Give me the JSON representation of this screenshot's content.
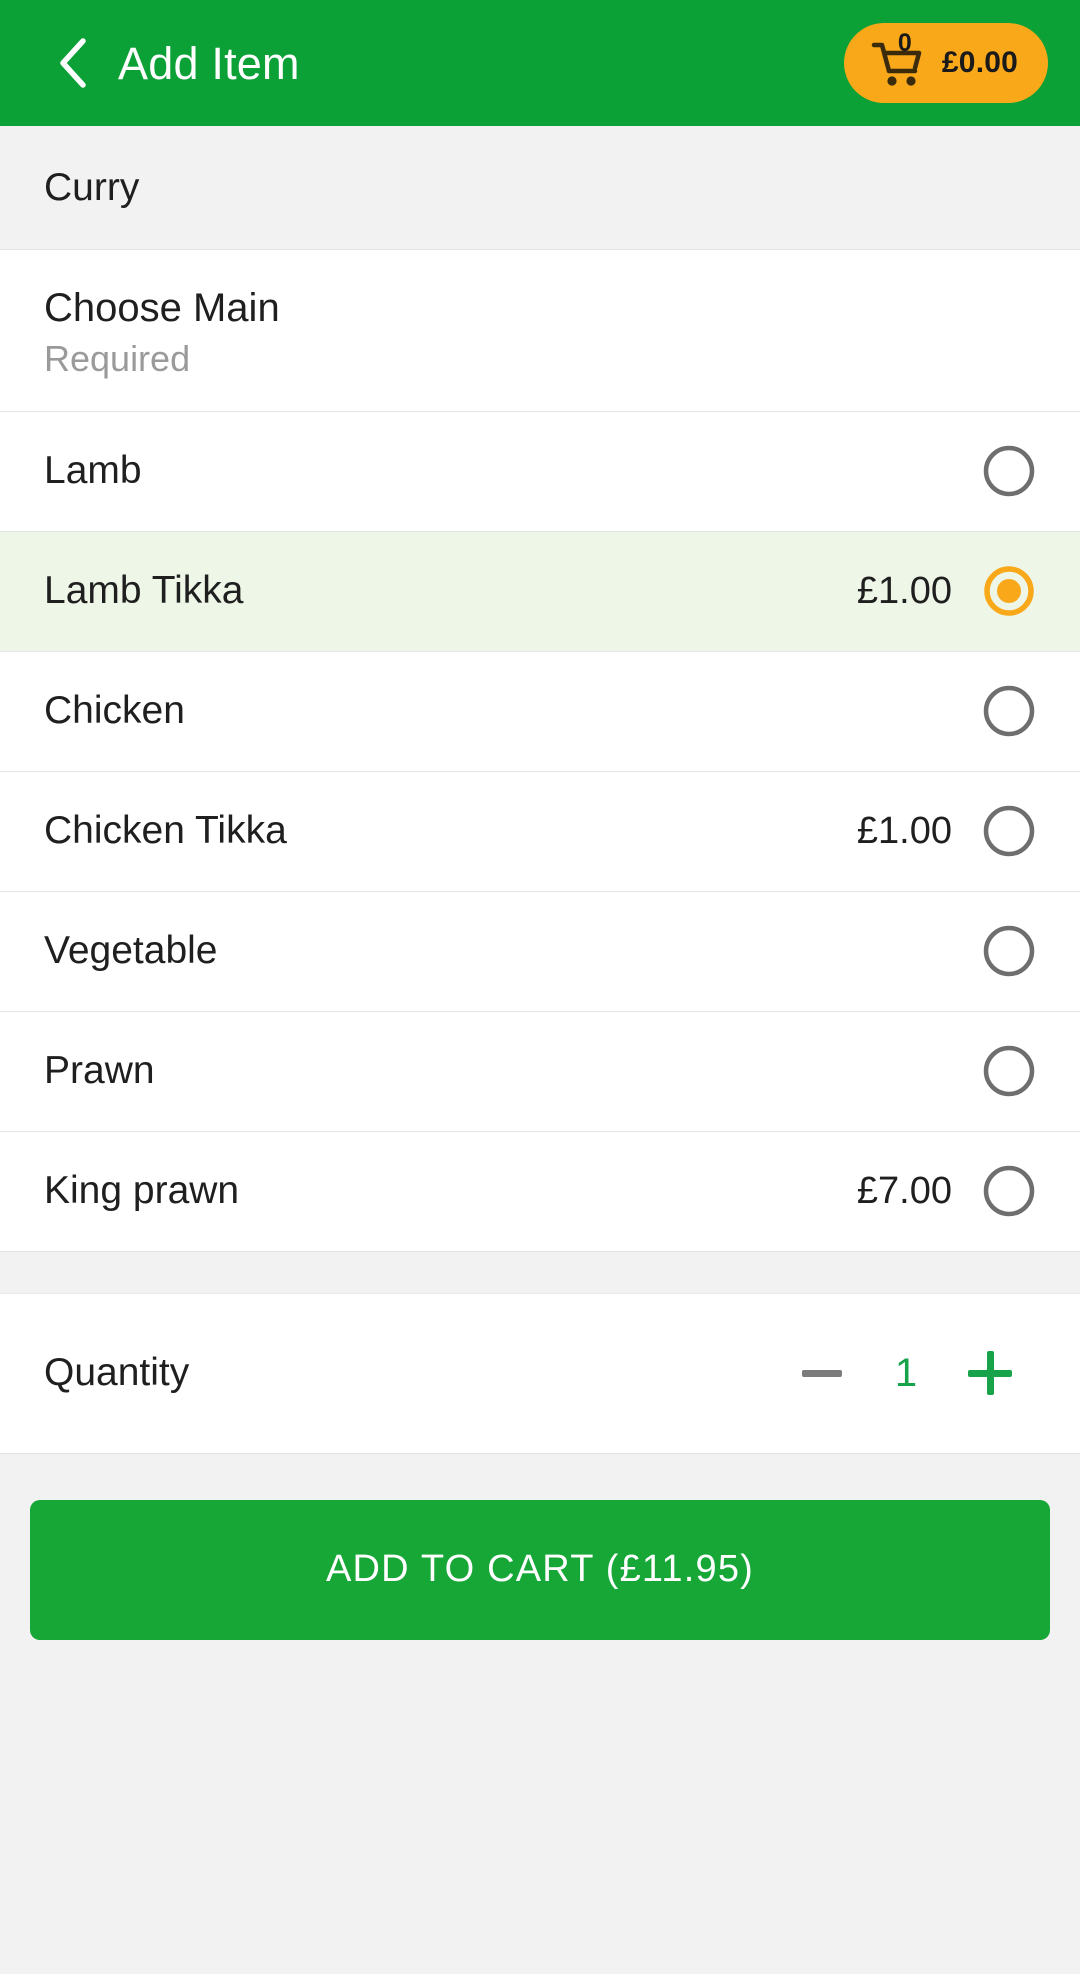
{
  "header": {
    "back_icon": "chevron-left-icon",
    "title": "Add Item",
    "cart": {
      "icon": "shopping-cart-icon",
      "count": "0",
      "total": "£0.00"
    }
  },
  "category": {
    "label": "Curry"
  },
  "group": {
    "title": "Choose Main",
    "subtitle": "Required"
  },
  "options": [
    {
      "label": "Lamb",
      "price": "",
      "selected": false
    },
    {
      "label": "Lamb Tikka",
      "price": "£1.00",
      "selected": true
    },
    {
      "label": "Chicken",
      "price": "",
      "selected": false
    },
    {
      "label": "Chicken Tikka",
      "price": "£1.00",
      "selected": false
    },
    {
      "label": "Vegetable",
      "price": "",
      "selected": false
    },
    {
      "label": "Prawn",
      "price": "",
      "selected": false
    },
    {
      "label": "King prawn",
      "price": "£7.00",
      "selected": false
    }
  ],
  "quantity": {
    "label": "Quantity",
    "value": "1",
    "minus_icon": "minus-icon",
    "plus_icon": "plus-icon"
  },
  "footer": {
    "add_to_cart_label": "ADD TO CART  (£11.95)"
  },
  "colors": {
    "brand_green": "#0BA136",
    "button_green": "#16A737",
    "accent_orange": "#F9A81A",
    "selected_row_bg": "#eef6e7",
    "band_gray": "#f2f2f2",
    "radio_unselected": "#6e6e6e",
    "muted_text": "#9a9a9a"
  }
}
